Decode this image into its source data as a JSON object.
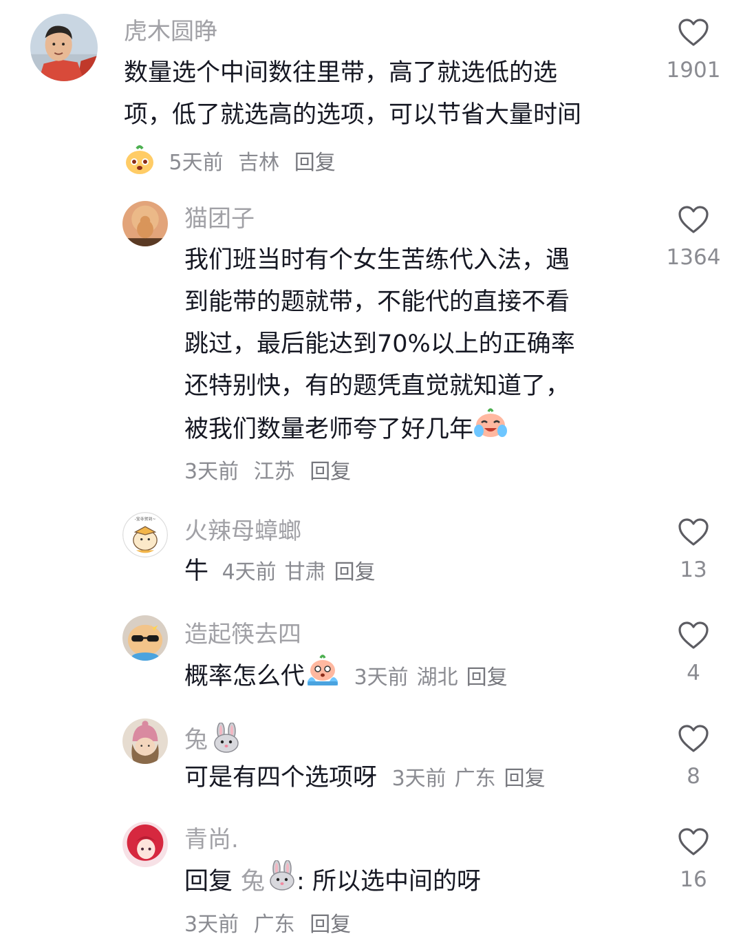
{
  "comments": [
    {
      "username": "虎木圆睁",
      "lines": [
        "数量选个中间数往里带，高了就选低的选",
        "项，低了就选高的选项，可以节省大量时间"
      ],
      "time": "5天前",
      "location": "吉林",
      "reply": "回复",
      "likes": "1901",
      "avatar_icon": "person-photo-avatar",
      "meta_emoji": "radish-face-emoji"
    },
    {
      "username": "猫团子",
      "lines": [
        "我们班当时有个女生苦练代入法，遇",
        "到能带的题就带，不能代的直接不看",
        "跳过，最后能达到70%以上的正确率",
        "还特别快，有的题凭直觉就知道了，",
        "被我们数量老师夸了好几年"
      ],
      "time": "3天前",
      "location": "江苏",
      "reply": "回复",
      "likes": "1364",
      "avatar_icon": "cat-photo-avatar",
      "trailing_emoji": "crying-face-emoji"
    },
    {
      "username": "火辣母蟑螂",
      "text": "牛",
      "time": "4天前",
      "location": "甘肃",
      "reply": "回复",
      "likes": "13",
      "avatar_icon": "cartoon-dog-avatar"
    },
    {
      "username": "造起筷去四",
      "text": "概率怎么代",
      "time": "3天前",
      "location": "湖北",
      "reply": "回复",
      "likes": "4",
      "avatar_icon": "sunglasses-dog-avatar",
      "trailing_emoji": "weeping-face-emoji"
    },
    {
      "username": "兔",
      "text": "可是有四个选项呀",
      "time": "3天前",
      "location": "广东",
      "reply": "回复",
      "likes": "8",
      "avatar_icon": "knit-hat-girl-avatar",
      "name_emoji": "rabbit-emoji"
    },
    {
      "username": "青尚.",
      "reply_prefix": "回复",
      "reply_to": "兔",
      "text": ": 所以选中间的呀",
      "time": "3天前",
      "location": "广东",
      "reply": "回复",
      "likes": "16",
      "avatar_icon": "red-hair-anime-avatar",
      "name_emoji": "rabbit-emoji"
    }
  ],
  "colors": {
    "text": "#161823",
    "secondary": "#a1a1a6",
    "meta": "#8a8b91"
  },
  "icons": {
    "like": "heart-outline-icon"
  }
}
